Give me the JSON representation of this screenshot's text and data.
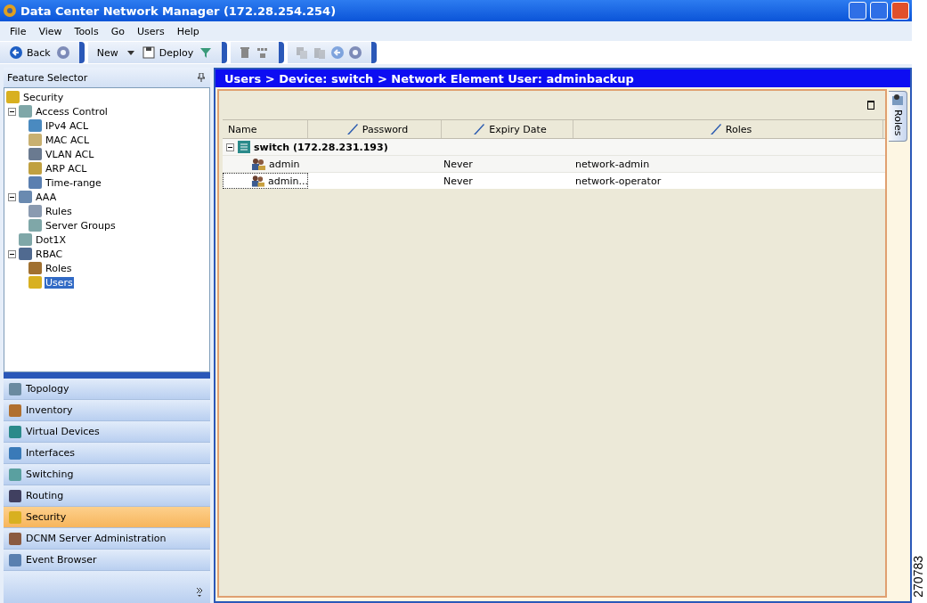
{
  "window": {
    "title": "Data Center Network Manager (172.28.254.254)"
  },
  "menu": [
    "File",
    "View",
    "Tools",
    "Go",
    "Users",
    "Help"
  ],
  "toolbar": [
    [
      {
        "kind": "button",
        "label": "Back",
        "disabled": false
      },
      {
        "kind": "icon",
        "disabled": true
      }
    ],
    [
      {
        "kind": "dropdown",
        "label": "New",
        "disabled": false
      },
      {
        "kind": "button",
        "label": "Deploy",
        "disabled": false
      },
      {
        "kind": "icon",
        "disabled": false
      }
    ],
    [
      {
        "kind": "icon",
        "disabled": false
      },
      {
        "kind": "icon",
        "disabled": false
      }
    ],
    [
      {
        "kind": "icon",
        "disabled": true
      },
      {
        "kind": "icon",
        "disabled": true
      },
      {
        "kind": "icon",
        "disabled": true
      },
      {
        "kind": "icon",
        "disabled": true
      }
    ]
  ],
  "feature_selector": {
    "title": "Feature Selector",
    "tree": [
      {
        "label": "Security",
        "selected": false,
        "children": [
          {
            "label": "Access Control",
            "selected": false,
            "expanded": true,
            "children": [
              {
                "label": "IPv4 ACL",
                "selected": false
              },
              {
                "label": "MAC ACL",
                "selected": false
              },
              {
                "label": "VLAN ACL",
                "selected": false
              },
              {
                "label": "ARP ACL",
                "selected": false
              },
              {
                "label": "Time-range",
                "selected": false
              }
            ]
          },
          {
            "label": "AAA",
            "selected": false,
            "expanded": true,
            "children": [
              {
                "label": "Rules",
                "selected": false
              },
              {
                "label": "Server Groups",
                "selected": false
              }
            ]
          },
          {
            "label": "Dot1X",
            "selected": false
          },
          {
            "label": "RBAC",
            "selected": false,
            "expanded": true,
            "children": [
              {
                "label": "Roles",
                "selected": false
              },
              {
                "label": "Users",
                "selected": true
              }
            ]
          }
        ]
      }
    ]
  },
  "nav": [
    {
      "label": "Topology",
      "selected": false
    },
    {
      "label": "Inventory",
      "selected": false
    },
    {
      "label": "Virtual Devices",
      "selected": false
    },
    {
      "label": "Interfaces",
      "selected": false
    },
    {
      "label": "Switching",
      "selected": false
    },
    {
      "label": "Routing",
      "selected": false
    },
    {
      "label": "Security",
      "selected": true
    },
    {
      "label": "DCNM Server Administration",
      "selected": false
    },
    {
      "label": "Event Browser",
      "selected": false
    }
  ],
  "content": {
    "breadcrumb": "Users > Device: switch > Network Element User: adminbackup",
    "table": {
      "columns": [
        {
          "label": "Name",
          "editable": false
        },
        {
          "label": "Password",
          "editable": true
        },
        {
          "label": "Expiry Date",
          "editable": true
        },
        {
          "label": "Roles",
          "editable": true
        }
      ],
      "groups": [
        {
          "label": "switch (172.28.231.193)",
          "expanded": true,
          "rows": [
            {
              "name": "admin",
              "expiry": "Never",
              "roles": "network-admin",
              "focused": false
            },
            {
              "name": "admin...",
              "expiry": "Never",
              "roles": "network-operator",
              "focused": true
            }
          ]
        }
      ]
    },
    "side_tab": "Roles"
  },
  "figure_id": "270783"
}
